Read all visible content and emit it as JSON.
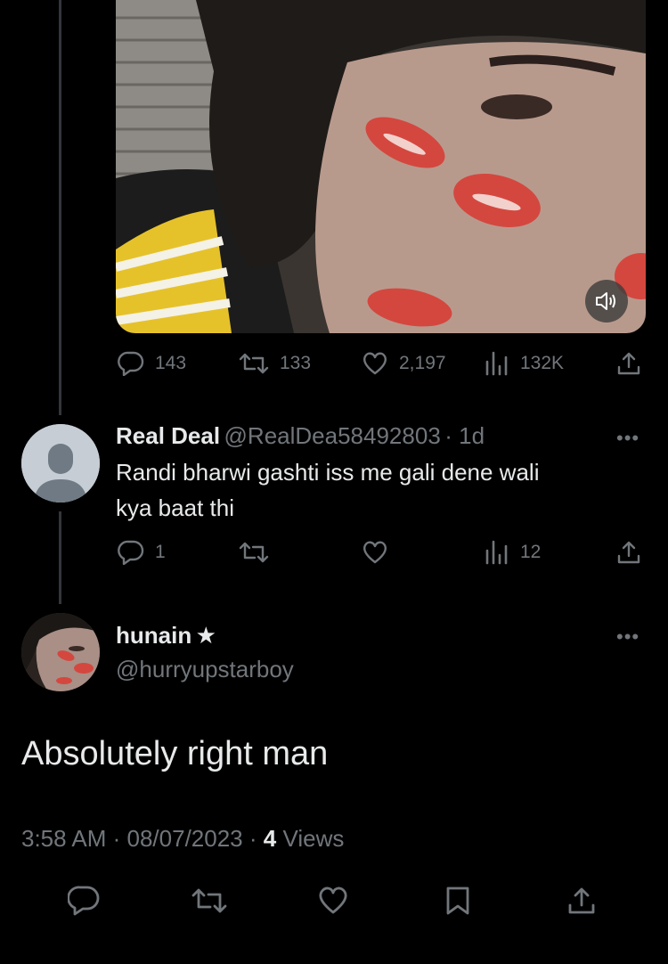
{
  "original_tweet": {
    "metrics": {
      "replies": "143",
      "retweets": "133",
      "likes": "2,197",
      "views": "132K"
    }
  },
  "reply": {
    "name": "Real Deal",
    "handle": "@RealDea58492803",
    "time": "· 1d",
    "text_line1": "Randi bharwi gashti iss me gali dene wali",
    "text_line2": "kya baat thi",
    "more": "•••",
    "metrics": {
      "replies": "1",
      "retweets": "",
      "likes": "",
      "views": "12"
    }
  },
  "main_tweet": {
    "name": "hunain",
    "badge": "★",
    "handle": "@hurryupstarboy",
    "more": "•••",
    "text": "Absolutely right man",
    "time": "3:58 AM",
    "sep1": " · ",
    "date": "08/07/2023",
    "sep2": " · ",
    "views_count": "4",
    "views_label": " Views"
  },
  "colors": {
    "background": "#000000",
    "text": "#e7e9ea",
    "muted": "#71767b",
    "thread_line": "#333639",
    "lip_red": "#d4473f"
  },
  "icons": [
    "speaker-icon",
    "reply-icon",
    "retweet-icon",
    "like-icon",
    "views-icon",
    "share-icon",
    "bookmark-icon"
  ]
}
